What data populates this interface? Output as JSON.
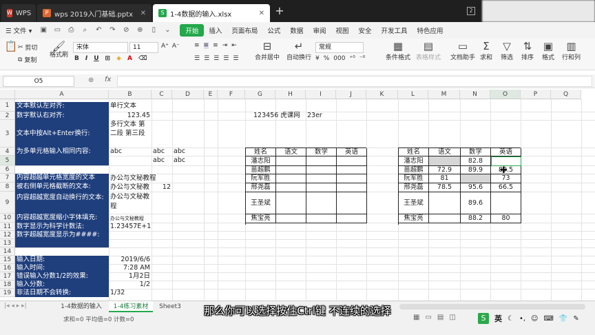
{
  "titlebar": {
    "tabs": [
      {
        "label": "WPS",
        "icon": "wps-logo-icon"
      },
      {
        "label": "wps 2019入门基础.pptx",
        "icon": "ppt-file-icon"
      },
      {
        "label": "1-4数据的输入.xlsx",
        "icon": "xlsx-file-icon"
      }
    ],
    "badge": "2"
  },
  "menubar": {
    "file": "文件",
    "items": [
      "开始",
      "插入",
      "页面布局",
      "公式",
      "数据",
      "审阅",
      "视图",
      "安全",
      "开发工具",
      "特色应用"
    ]
  },
  "ribbon": {
    "cut": "剪切",
    "copy": "复制",
    "format_painter": "格式刷",
    "font": "宋体",
    "size": "11",
    "merge": "合并居中",
    "wrap": "自动换行",
    "num_format": "常规",
    "cond_format": "条件格式",
    "table_style": "表格样式",
    "doc_helper": "文档助手",
    "sum": "求和",
    "filter": "筛选",
    "sort": "排序",
    "format": "格式",
    "rowcol": "行和列"
  },
  "formula": {
    "namebox": "O5",
    "fx": "fx"
  },
  "columns": [
    "A",
    "B",
    "C",
    "D",
    "E",
    "F",
    "G",
    "H",
    "I",
    "J",
    "K",
    "L",
    "M",
    "N",
    "O",
    "P",
    "Q"
  ],
  "rows": [
    "1",
    "2",
    "3",
    "4",
    "5",
    "6",
    "7",
    "8",
    "9",
    "10",
    "11",
    "12",
    "13",
    "14",
    "15",
    "16",
    "17",
    "18",
    "19"
  ],
  "cells": {
    "a1": "文本默认左对齐:",
    "b1": "单行文本",
    "a2": "数字默认右对齐:",
    "b2": "123.45",
    "a3": "文本中按Alt+Enter换行:",
    "b3": "多行文本 第二段 第三段",
    "a4": "为多单元格输入相同内容:",
    "b4": "abc",
    "c4": "abc",
    "d4": "abc",
    "c5": "abc",
    "d5": "abc",
    "a7": "内容超越单元格宽度的文本",
    "b7": "办公与文秘教程",
    "a8": "被右侧单元格截断的文本:",
    "b8": "办公与文秘教",
    "c8": "12",
    "a9": "内容超越宽度自动换行的文本:",
    "b9": "办公与文秘教程",
    "a10": "内容超越宽度缩小字体填充:",
    "b10": "办公与文秘教程",
    "a11": "数字显示为科学计数法:",
    "b11": "1.23457E+12",
    "a12": "数字超越宽度显示为####:",
    "a15": "输入日期:",
    "b15": "2019/6/6",
    "a16": "输入时间:",
    "b16": "7:28 AM",
    "a17": "错误输入分数1/2的效果:",
    "b17": "1月2日",
    "a18": "输入分数:",
    "b18": "1/2",
    "a19": "非法日期不会转换:",
    "b19": "1/32",
    "g2": "123456 虎课网",
    "i2": "23er"
  },
  "table_left": {
    "headers": [
      "姓名",
      "语文",
      "数学",
      "英语"
    ],
    "names": [
      "潘志阳",
      "苗超鹏",
      "阮军胜",
      "邢尧磊",
      "王圣斌",
      "焦宝亮"
    ]
  },
  "table_right": {
    "headers": [
      "姓名",
      "语文",
      "数学",
      "英语"
    ],
    "rows": [
      [
        "潘志阳",
        "",
        "82.8",
        ""
      ],
      [
        "苗超鹏",
        "72.9",
        "89.9",
        "89.5"
      ],
      [
        "阮军胜",
        "81",
        "",
        "73"
      ],
      [
        "邢尧磊",
        "78.5",
        "95.6",
        "66.5"
      ],
      [
        "王圣斌",
        "",
        "89.6",
        ""
      ],
      [
        "焦宝亮",
        "",
        "88.2",
        "80"
      ]
    ]
  },
  "sheets": [
    "1-4数据的输入",
    "1-4练习素材",
    "Sheet3"
  ],
  "status": {
    "stats": "求和=0  平均值=0  计数=0",
    "ime": "英"
  },
  "subtitle": "那么你可以选择按住Ctrl键 不连续的选择",
  "colors": {
    "accent": "#23a84b",
    "header_blue": "#1f3e7c"
  }
}
